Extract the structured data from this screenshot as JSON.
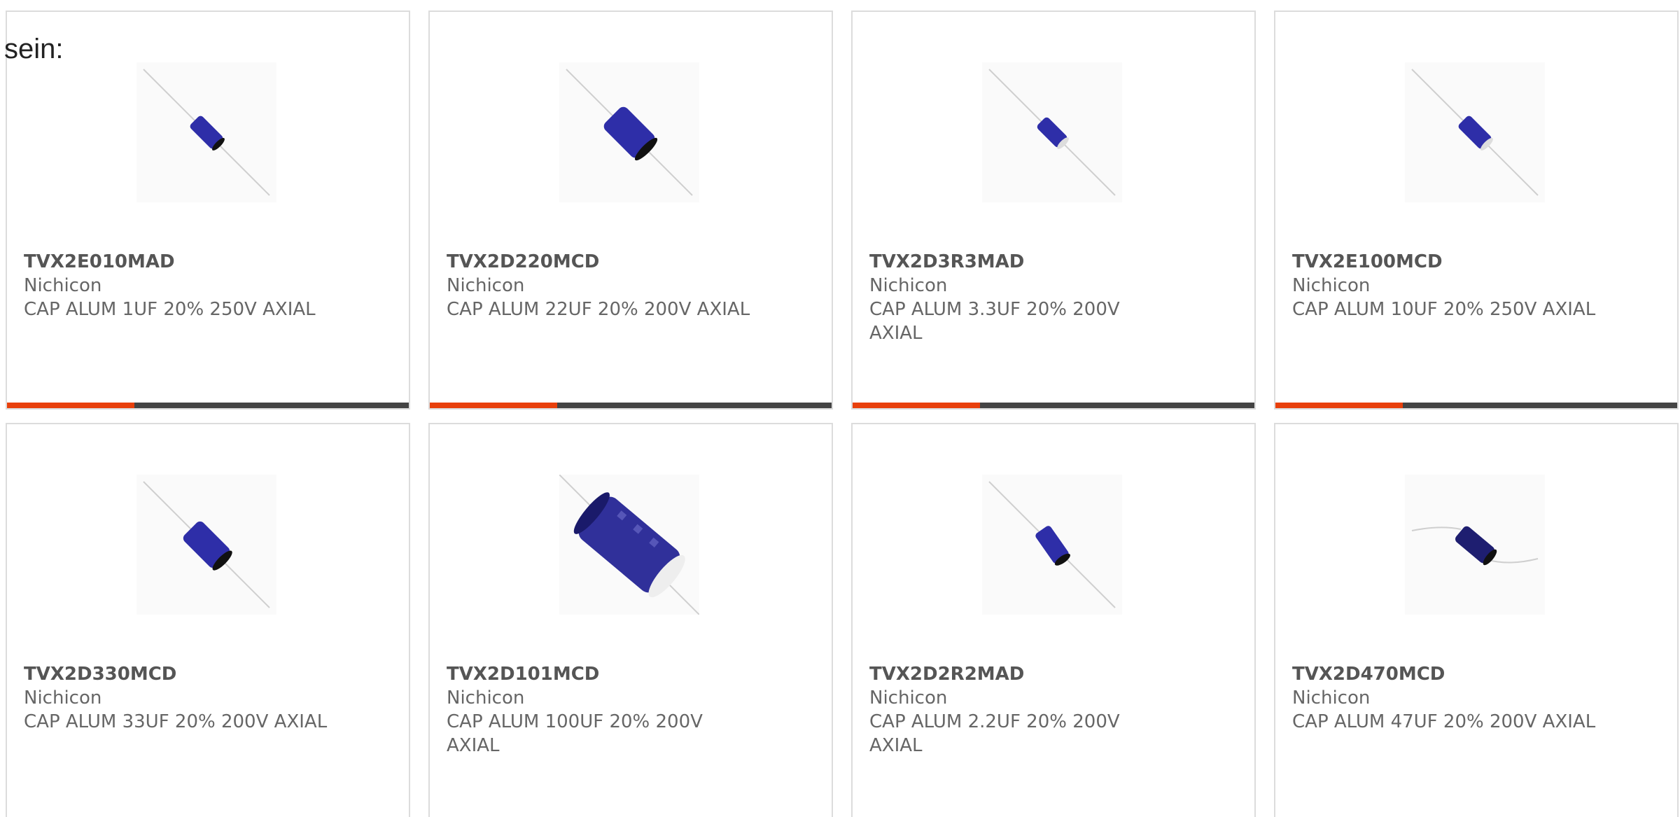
{
  "intro_text": "sein:",
  "colors": {
    "accent": "#e8400c",
    "bar": "#444444",
    "capacitor": "#2a2aa0"
  },
  "products": [
    {
      "part": "TVX2E010MAD",
      "manufacturer": "Nichicon",
      "description": "CAP ALUM 1UF 20% 250V AXIAL",
      "image_icon": "axial-capacitor-icon"
    },
    {
      "part": "TVX2D220MCD",
      "manufacturer": "Nichicon",
      "description": "CAP ALUM 22UF 20% 200V AXIAL",
      "image_icon": "axial-capacitor-icon"
    },
    {
      "part": "TVX2D3R3MAD",
      "manufacturer": "Nichicon",
      "description": "CAP ALUM 3.3UF 20% 200V AXIAL",
      "image_icon": "axial-capacitor-icon"
    },
    {
      "part": "TVX2E100MCD",
      "manufacturer": "Nichicon",
      "description": "CAP ALUM 10UF 20% 250V AXIAL",
      "image_icon": "axial-capacitor-icon"
    },
    {
      "part": "TVX2D330MCD",
      "manufacturer": "Nichicon",
      "description": "CAP ALUM 33UF 20% 200V AXIAL",
      "image_icon": "axial-capacitor-icon"
    },
    {
      "part": "TVX2D101MCD",
      "manufacturer": "Nichicon",
      "description": "CAP ALUM 100UF 20% 200V AXIAL",
      "image_icon": "axial-capacitor-icon"
    },
    {
      "part": "TVX2D2R2MAD",
      "manufacturer": "Nichicon",
      "description": "CAP ALUM 2.2UF 20% 200V AXIAL",
      "image_icon": "axial-capacitor-icon"
    },
    {
      "part": "TVX2D470MCD",
      "manufacturer": "Nichicon",
      "description": "CAP ALUM 47UF 20% 200V AXIAL",
      "image_icon": "axial-capacitor-icon"
    }
  ]
}
